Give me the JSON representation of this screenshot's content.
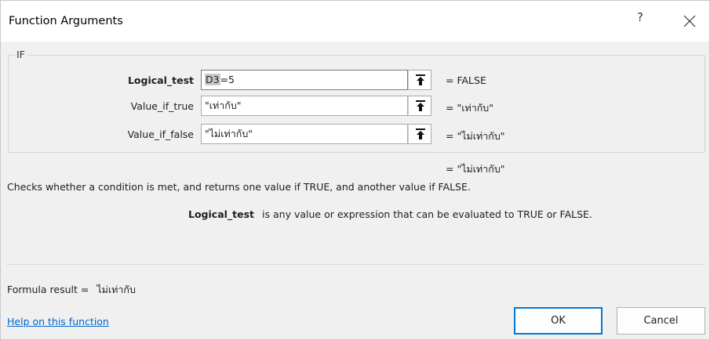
{
  "dialog": {
    "title": "Function Arguments",
    "help_glyph": "?",
    "close_glyph": "✕"
  },
  "function_name": "IF",
  "arguments": [
    {
      "label": "Logical_test",
      "value_selected": "D3",
      "value_rest": "=5",
      "result": "=   FALSE"
    },
    {
      "label": "Value_if_true",
      "value": "\"เท่ากับ\"",
      "result": "=   \"เท่ากับ\""
    },
    {
      "label": "Value_if_false",
      "value": "\"ไม่เท่ากับ\"",
      "result": "=   \"ไม่เท่ากับ\""
    }
  ],
  "overall_result": "=   \"ไม่เท่ากับ\"",
  "description": "Checks whether a condition is met, and returns one value if TRUE, and another value if FALSE.",
  "argument_help": {
    "name": "Logical_test",
    "text": "is any value or expression that can be evaluated to TRUE or FALSE."
  },
  "formula_result": {
    "label": "Formula result =",
    "value": "ไม่เท่ากับ"
  },
  "help_link": "Help on this function",
  "buttons": {
    "ok": "OK",
    "cancel": "Cancel"
  }
}
